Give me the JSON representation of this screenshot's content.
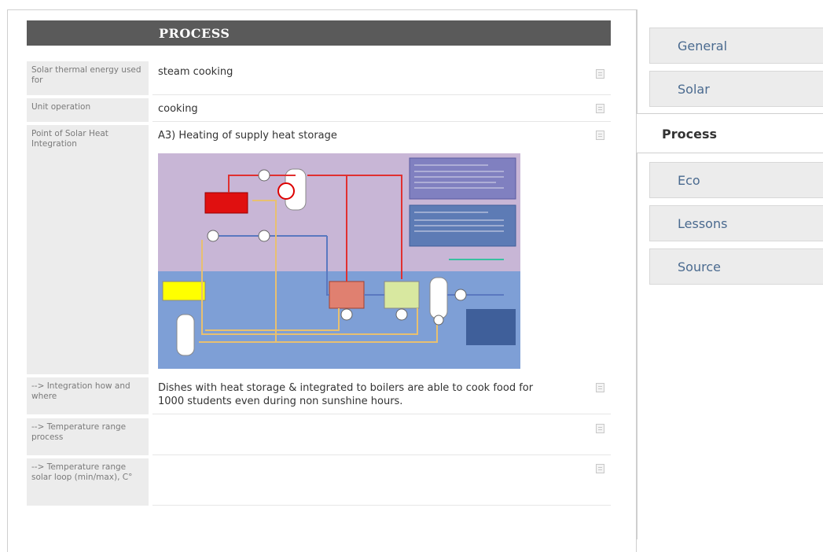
{
  "section": {
    "title": "PROCESS"
  },
  "rows": [
    {
      "label": "Solar thermal energy used for",
      "value": "steam cooking"
    },
    {
      "label": "Unit operation",
      "value": "cooking"
    },
    {
      "label": "Point of Solar Heat Integration",
      "value": "A3) Heating of supply heat storage"
    },
    {
      "label": "--> Integration how and where",
      "value": "Dishes with heat storage & integrated to boilers are able to cook food for 1000 students even during non sunshine hours."
    },
    {
      "label": "--> Temperature range process",
      "value": ""
    },
    {
      "label": "--> Temperature range solar loop (min/max), C°",
      "value": ""
    }
  ],
  "tabs": {
    "general": "General",
    "solar": "Solar",
    "process": "Process",
    "eco": "Eco",
    "lessons": "Lessons",
    "source": "Source"
  },
  "colors": {
    "header_bg": "#5a5a5a",
    "label_bg": "#ececec",
    "tab_bg": "#ececec",
    "tab_text": "#4a6a8f",
    "diagram_top": "#c5b3d4",
    "diagram_bottom": "#7e9fd6"
  },
  "icons": [
    "edit-icon"
  ]
}
